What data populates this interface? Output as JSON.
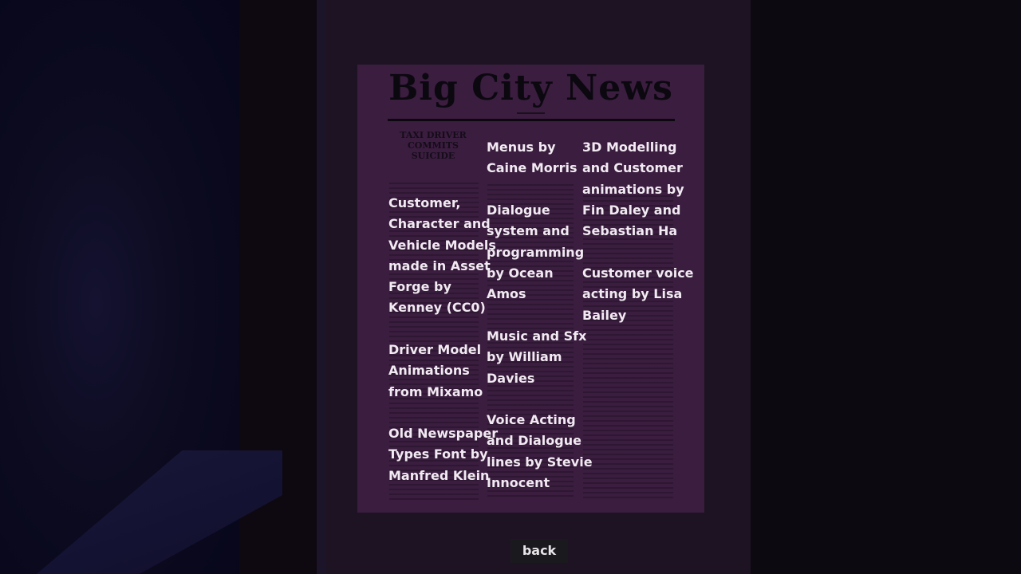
{
  "newspaper": {
    "masthead": "Big City News",
    "headline": "TAXI DRIVER\nCOMMITS\nSUICIDE"
  },
  "credits": {
    "col1": [
      "Customer,\nCharacter and\nVehicle Models\nmade in Asset\nForge by\nKenney (CC0)",
      "Driver Model\nAnimations\nfrom Mixamo",
      "Old Newspaper\nTypes Font by\nManfred Klein"
    ],
    "col2": [
      "Menus by\nCaine Morris",
      "Dialogue\nsystem and\nprogramming\nby Ocean\nAmos",
      "Music and Sfx\nby William\nDavies",
      "Voice Acting\nand Dialogue\nlines by Stevie\nInnocent"
    ],
    "col3": [
      "3D Modelling\nand Customer\nanimations by\nFin Daley and\nSebastian Ha",
      "Customer voice\nacting by Lisa\nBailey"
    ]
  },
  "buttons": {
    "back_label": "back"
  },
  "colors": {
    "newspaper": "#3a1d3f",
    "panel": "#1e1322",
    "text": "#f2eaf2",
    "ink": "#0c0810"
  }
}
